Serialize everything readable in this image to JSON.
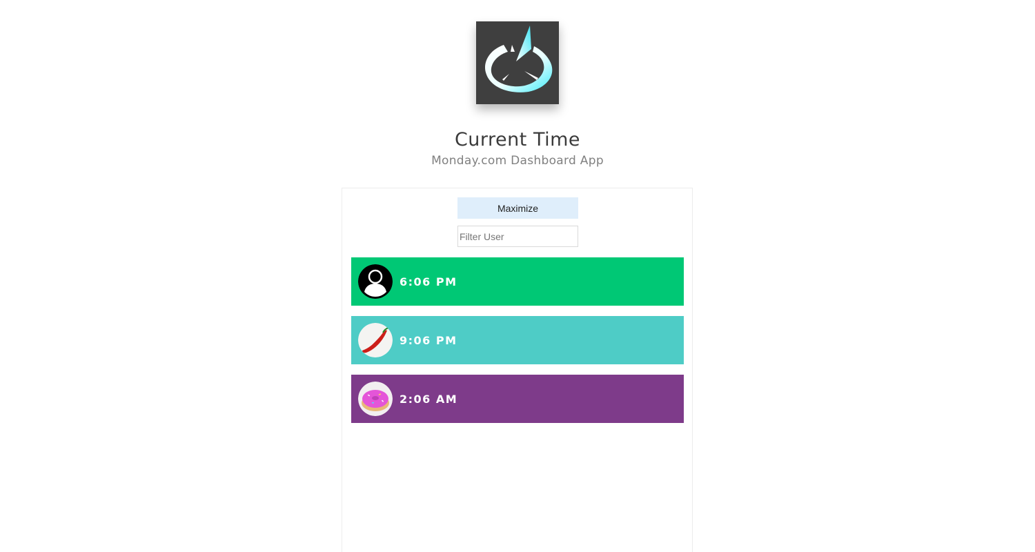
{
  "header": {
    "title": "Current Time",
    "subtitle": "Monday.com Dashboard App",
    "logo_icon": "clock-logo-icon"
  },
  "controls": {
    "maximize_label": "Maximize",
    "filter_placeholder": "Filter User",
    "filter_value": ""
  },
  "users": [
    {
      "time": "6:06 PM",
      "color": "#00c875",
      "avatar_icon": "default-user-avatar-icon"
    },
    {
      "time": "9:06 PM",
      "color": "#4eccc6",
      "avatar_icon": "chili-pepper-avatar-icon"
    },
    {
      "time": "2:06 AM",
      "color": "#7e3b8a",
      "avatar_icon": "donut-avatar-icon"
    }
  ]
}
